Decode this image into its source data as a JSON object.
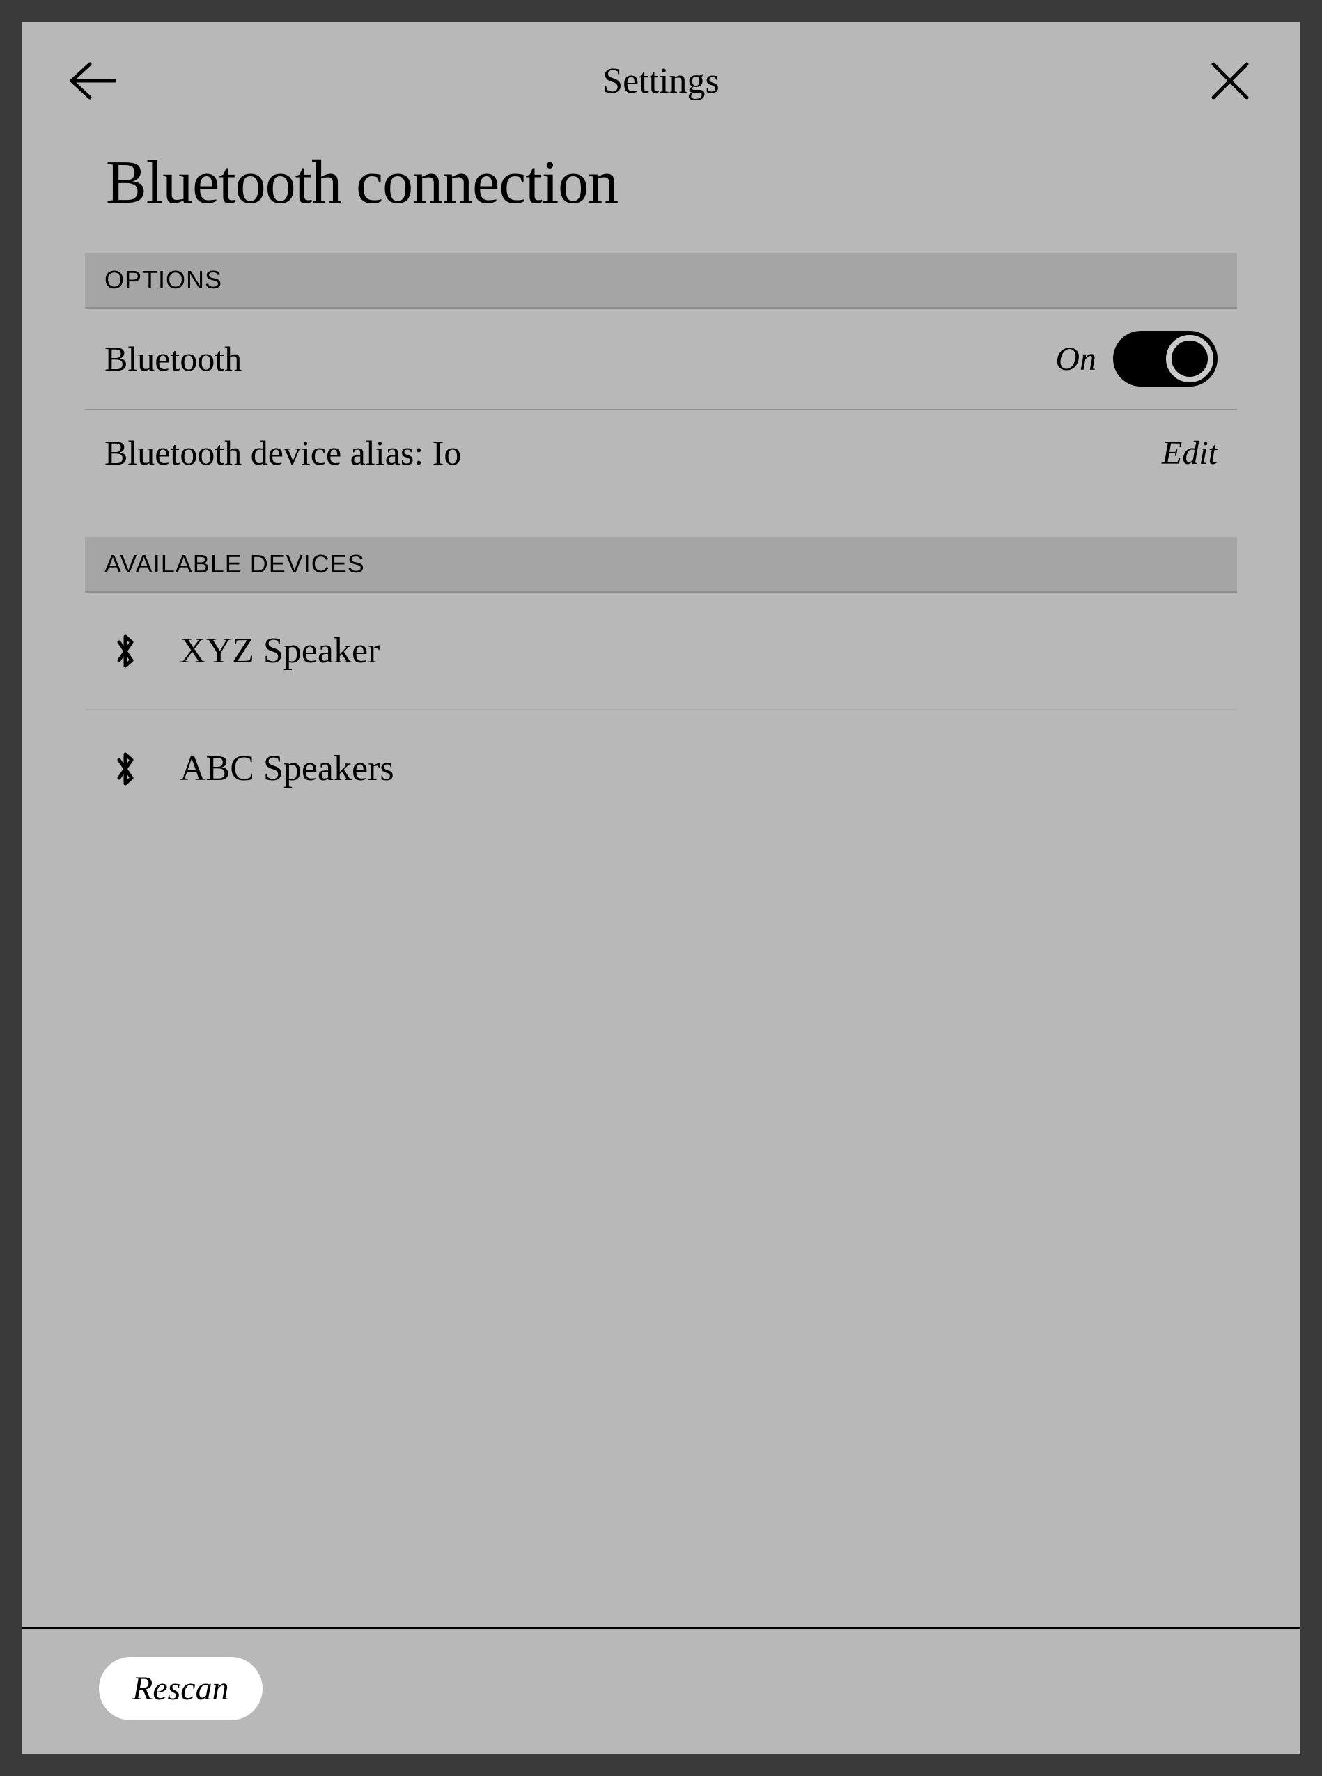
{
  "header": {
    "title": "Settings"
  },
  "page": {
    "title": "Bluetooth connection"
  },
  "options": {
    "section_label": "OPTIONS",
    "bluetooth_label": "Bluetooth",
    "bluetooth_state": "On",
    "alias_label": "Bluetooth device alias: Io",
    "edit_label": "Edit"
  },
  "devices": {
    "section_label": "AVAILABLE DEVICES",
    "items": [
      {
        "name": "XYZ Speaker"
      },
      {
        "name": "ABC Speakers"
      }
    ]
  },
  "footer": {
    "rescan_label": "Rescan"
  }
}
